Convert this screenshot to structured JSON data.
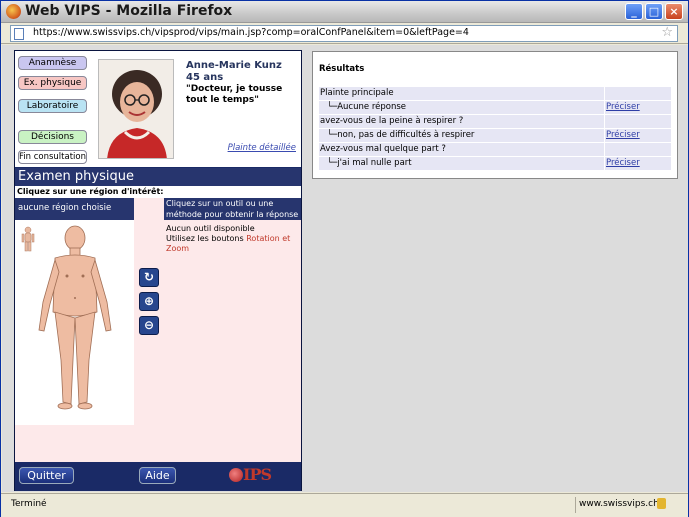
{
  "window": {
    "title": "Web VIPS - Mozilla Firefox"
  },
  "browser": {
    "url": "https://www.swissvips.ch/vipsprod/vips/main.jsp?comp=oralConfPanel&item=0&leftPage=4",
    "status": "Terminé",
    "host": "www.swissvips.ch"
  },
  "nav": {
    "items": [
      {
        "label": "Anamnèse",
        "color": "#c9c6f0"
      },
      {
        "label": "Ex. physique",
        "color": "#f7c7c4"
      },
      {
        "label": "Laboratoire",
        "color": "#b9e3f3"
      },
      {
        "label": "Décisions",
        "color": "#c9f2c3"
      },
      {
        "label": "Fin consultation",
        "color": "#ffffff"
      }
    ]
  },
  "patient": {
    "name": "Anne-Marie Kunz",
    "age": "45 ans",
    "quote": "\"Docteur, je tousse tout le temps\"",
    "complaint_link": "Plainte détaillée"
  },
  "exam": {
    "title": "Examen physique",
    "subtitle": "Cliquez sur une région d'intérêt:",
    "region": "aucune région choisie",
    "instructions": "Cliquez sur un outil ou une méthode pour obtenir la réponse",
    "no_tool": "Aucun outil disponible",
    "hint_prefix": "Utilisez les boutons",
    "hint_rotation": "Rotation et",
    "hint_zoom": "Zoom"
  },
  "footer": {
    "quit_label": "Quitter",
    "help_label": "Aide",
    "logo_text": "IPS"
  },
  "results": {
    "title": "Résultats",
    "rows": [
      {
        "type": "q",
        "text": "Plainte principale",
        "action": ""
      },
      {
        "type": "a",
        "text": "└─Aucune réponse",
        "action": "Préciser"
      },
      {
        "type": "q",
        "text": "avez-vous de la peine à respirer ?",
        "action": ""
      },
      {
        "type": "a",
        "text": "└─non, pas de difficultés à respirer",
        "action": "Préciser"
      },
      {
        "type": "q",
        "text": "Avez-vous mal quelque part ?",
        "action": ""
      },
      {
        "type": "a",
        "text": "└─j'ai mal nulle part",
        "action": "Préciser"
      }
    ]
  }
}
